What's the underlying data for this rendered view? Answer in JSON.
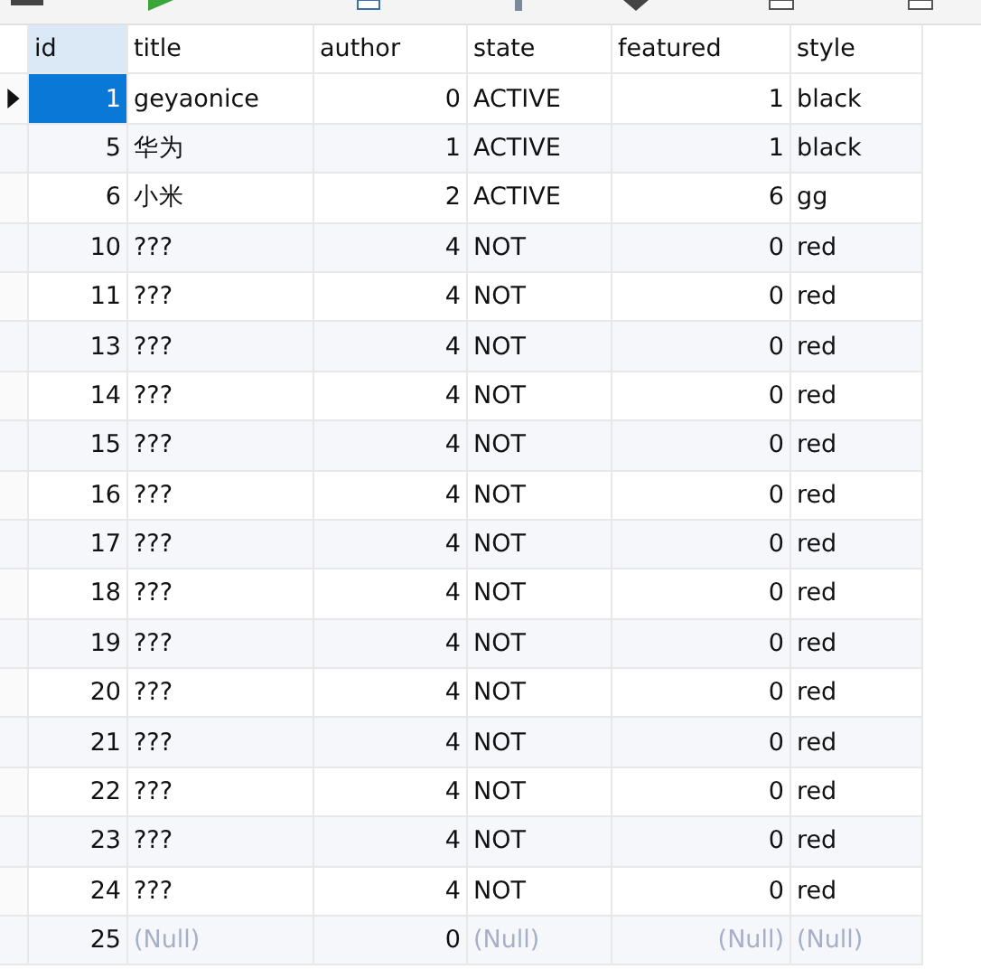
{
  "columns": [
    {
      "label": "id",
      "numeric": true,
      "selected": true
    },
    {
      "label": "title",
      "numeric": false,
      "selected": false
    },
    {
      "label": "author",
      "numeric": true,
      "selected": false
    },
    {
      "label": "state",
      "numeric": false,
      "selected": false
    },
    {
      "label": "featured",
      "numeric": true,
      "selected": false
    },
    {
      "label": "style",
      "numeric": false,
      "selected": false
    }
  ],
  "rows": [
    {
      "selected": true,
      "cells": [
        {
          "text": "1",
          "null": false
        },
        {
          "text": "geyaonice",
          "null": false
        },
        {
          "text": "0",
          "null": false
        },
        {
          "text": "ACTIVE",
          "null": false
        },
        {
          "text": "1",
          "null": false
        },
        {
          "text": "black",
          "null": false
        }
      ]
    },
    {
      "selected": false,
      "cells": [
        {
          "text": "5",
          "null": false
        },
        {
          "text": "华为",
          "null": false
        },
        {
          "text": "1",
          "null": false
        },
        {
          "text": "ACTIVE",
          "null": false
        },
        {
          "text": "1",
          "null": false
        },
        {
          "text": "black",
          "null": false
        }
      ]
    },
    {
      "selected": false,
      "cells": [
        {
          "text": "6",
          "null": false
        },
        {
          "text": "小米",
          "null": false
        },
        {
          "text": "2",
          "null": false
        },
        {
          "text": "ACTIVE",
          "null": false
        },
        {
          "text": "6",
          "null": false
        },
        {
          "text": "gg",
          "null": false
        }
      ]
    },
    {
      "selected": false,
      "cells": [
        {
          "text": "10",
          "null": false
        },
        {
          "text": "???",
          "null": false
        },
        {
          "text": "4",
          "null": false
        },
        {
          "text": "NOT",
          "null": false
        },
        {
          "text": "0",
          "null": false
        },
        {
          "text": "red",
          "null": false
        }
      ]
    },
    {
      "selected": false,
      "cells": [
        {
          "text": "11",
          "null": false
        },
        {
          "text": "???",
          "null": false
        },
        {
          "text": "4",
          "null": false
        },
        {
          "text": "NOT",
          "null": false
        },
        {
          "text": "0",
          "null": false
        },
        {
          "text": "red",
          "null": false
        }
      ]
    },
    {
      "selected": false,
      "cells": [
        {
          "text": "13",
          "null": false
        },
        {
          "text": "???",
          "null": false
        },
        {
          "text": "4",
          "null": false
        },
        {
          "text": "NOT",
          "null": false
        },
        {
          "text": "0",
          "null": false
        },
        {
          "text": "red",
          "null": false
        }
      ]
    },
    {
      "selected": false,
      "cells": [
        {
          "text": "14",
          "null": false
        },
        {
          "text": "???",
          "null": false
        },
        {
          "text": "4",
          "null": false
        },
        {
          "text": "NOT",
          "null": false
        },
        {
          "text": "0",
          "null": false
        },
        {
          "text": "red",
          "null": false
        }
      ]
    },
    {
      "selected": false,
      "cells": [
        {
          "text": "15",
          "null": false
        },
        {
          "text": "???",
          "null": false
        },
        {
          "text": "4",
          "null": false
        },
        {
          "text": "NOT",
          "null": false
        },
        {
          "text": "0",
          "null": false
        },
        {
          "text": "red",
          "null": false
        }
      ]
    },
    {
      "selected": false,
      "cells": [
        {
          "text": "16",
          "null": false
        },
        {
          "text": "???",
          "null": false
        },
        {
          "text": "4",
          "null": false
        },
        {
          "text": "NOT",
          "null": false
        },
        {
          "text": "0",
          "null": false
        },
        {
          "text": "red",
          "null": false
        }
      ]
    },
    {
      "selected": false,
      "cells": [
        {
          "text": "17",
          "null": false
        },
        {
          "text": "???",
          "null": false
        },
        {
          "text": "4",
          "null": false
        },
        {
          "text": "NOT",
          "null": false
        },
        {
          "text": "0",
          "null": false
        },
        {
          "text": "red",
          "null": false
        }
      ]
    },
    {
      "selected": false,
      "cells": [
        {
          "text": "18",
          "null": false
        },
        {
          "text": "???",
          "null": false
        },
        {
          "text": "4",
          "null": false
        },
        {
          "text": "NOT",
          "null": false
        },
        {
          "text": "0",
          "null": false
        },
        {
          "text": "red",
          "null": false
        }
      ]
    },
    {
      "selected": false,
      "cells": [
        {
          "text": "19",
          "null": false
        },
        {
          "text": "???",
          "null": false
        },
        {
          "text": "4",
          "null": false
        },
        {
          "text": "NOT",
          "null": false
        },
        {
          "text": "0",
          "null": false
        },
        {
          "text": "red",
          "null": false
        }
      ]
    },
    {
      "selected": false,
      "cells": [
        {
          "text": "20",
          "null": false
        },
        {
          "text": "???",
          "null": false
        },
        {
          "text": "4",
          "null": false
        },
        {
          "text": "NOT",
          "null": false
        },
        {
          "text": "0",
          "null": false
        },
        {
          "text": "red",
          "null": false
        }
      ]
    },
    {
      "selected": false,
      "cells": [
        {
          "text": "21",
          "null": false
        },
        {
          "text": "???",
          "null": false
        },
        {
          "text": "4",
          "null": false
        },
        {
          "text": "NOT",
          "null": false
        },
        {
          "text": "0",
          "null": false
        },
        {
          "text": "red",
          "null": false
        }
      ]
    },
    {
      "selected": false,
      "cells": [
        {
          "text": "22",
          "null": false
        },
        {
          "text": "???",
          "null": false
        },
        {
          "text": "4",
          "null": false
        },
        {
          "text": "NOT",
          "null": false
        },
        {
          "text": "0",
          "null": false
        },
        {
          "text": "red",
          "null": false
        }
      ]
    },
    {
      "selected": false,
      "cells": [
        {
          "text": "23",
          "null": false
        },
        {
          "text": "???",
          "null": false
        },
        {
          "text": "4",
          "null": false
        },
        {
          "text": "NOT",
          "null": false
        },
        {
          "text": "0",
          "null": false
        },
        {
          "text": "red",
          "null": false
        }
      ]
    },
    {
      "selected": false,
      "cells": [
        {
          "text": "24",
          "null": false
        },
        {
          "text": "???",
          "null": false
        },
        {
          "text": "4",
          "null": false
        },
        {
          "text": "NOT",
          "null": false
        },
        {
          "text": "0",
          "null": false
        },
        {
          "text": "red",
          "null": false
        }
      ]
    },
    {
      "selected": false,
      "cells": [
        {
          "text": "25",
          "null": false
        },
        {
          "text": "(Null)",
          "null": true
        },
        {
          "text": "0",
          "null": false
        },
        {
          "text": "(Null)",
          "null": true
        },
        {
          "text": "(Null)",
          "null": true
        },
        {
          "text": "(Null)",
          "null": true
        }
      ]
    }
  ]
}
